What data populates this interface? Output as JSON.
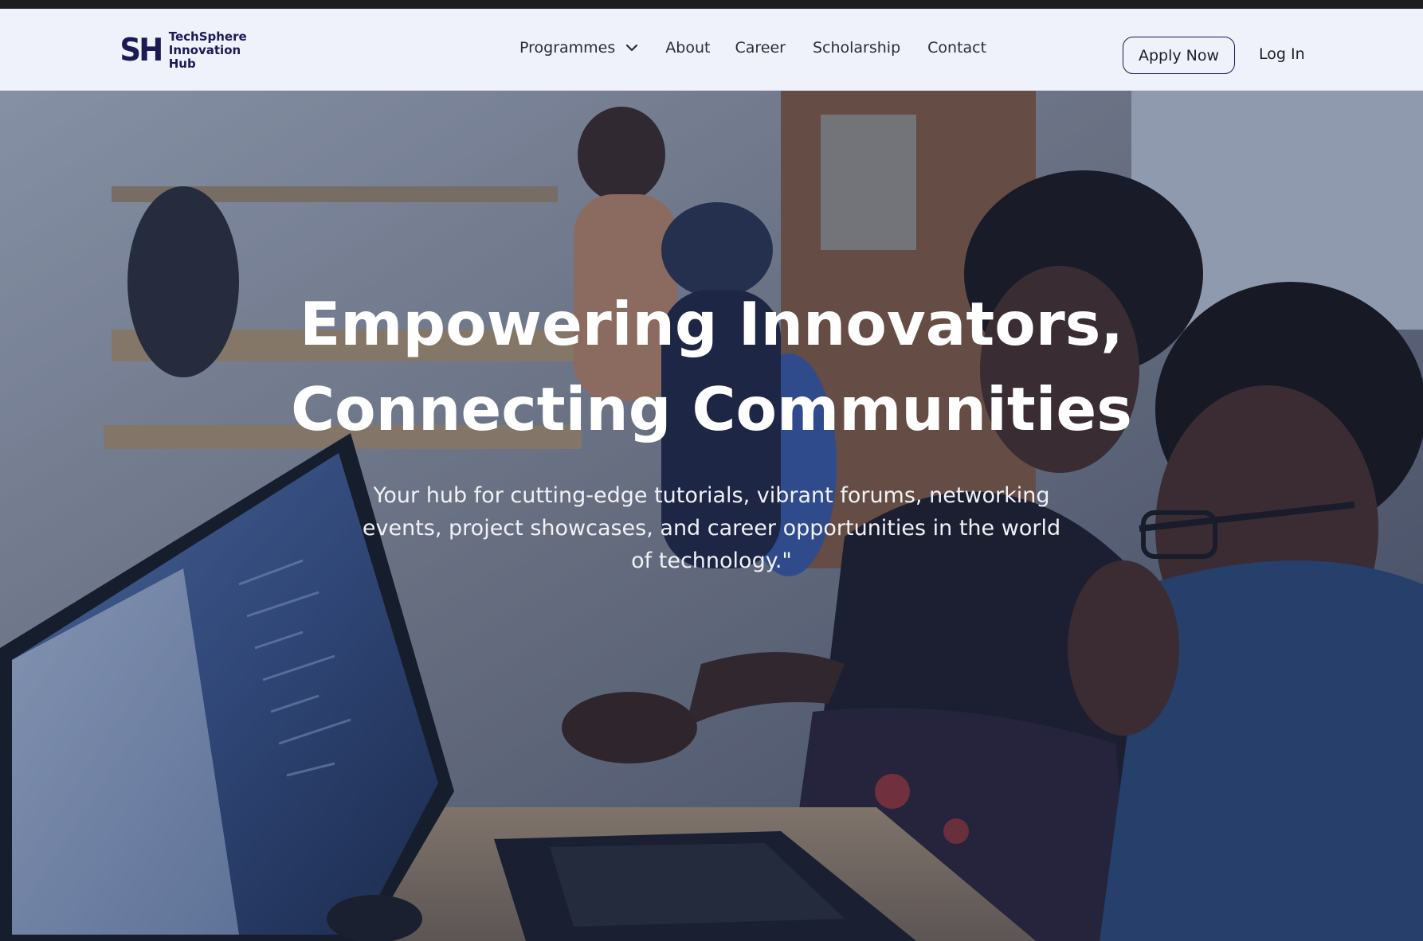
{
  "brand": {
    "mark": "SH",
    "name_line1": "TechSphere",
    "name_line2": "Innovation",
    "name_line3": "Hub",
    "color": "#1c1a55"
  },
  "nav": {
    "items": [
      {
        "label": "Programmes",
        "has_dropdown": true
      },
      {
        "label": "About"
      },
      {
        "label": "Career"
      },
      {
        "label": "Scholarship"
      },
      {
        "label": "Contact"
      }
    ],
    "dropdown_icon": "chevron-down-icon"
  },
  "actions": {
    "apply_label": "Apply Now",
    "login_label": "Log In"
  },
  "hero": {
    "title_line1": "Empowering Innovators,",
    "title_line2": "Connecting Communities",
    "subtitle": "Your hub for cutting-edge tutorials, vibrant forums, networking events, project showcases, and career opportunities in the world of technology.\""
  },
  "colors": {
    "nav_background": "#eff1fb",
    "hero_text": "#ffffff"
  }
}
